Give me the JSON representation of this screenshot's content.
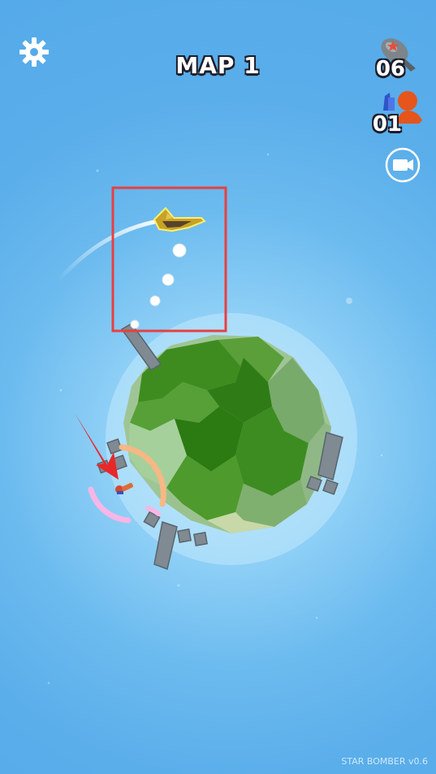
{
  "hud": {
    "map_title": "MAP 1",
    "bombs_remaining": "06",
    "enemies_remaining": "01"
  },
  "icons": {
    "settings": "gear-icon",
    "bombs": "bomb-icon",
    "enemies": "enemy-soldier-icon",
    "camera": "video-camera-icon"
  },
  "footer": {
    "version": "STAR BOMBER v0.6"
  },
  "colors": {
    "sky": "#55aae9",
    "planet_green": "#3f8f23",
    "highlight_box": "#e8403f",
    "target_arrow": "#e8272a",
    "target_ring_orange": "#f6b884",
    "target_ring_pink": "#f7b6e6"
  }
}
